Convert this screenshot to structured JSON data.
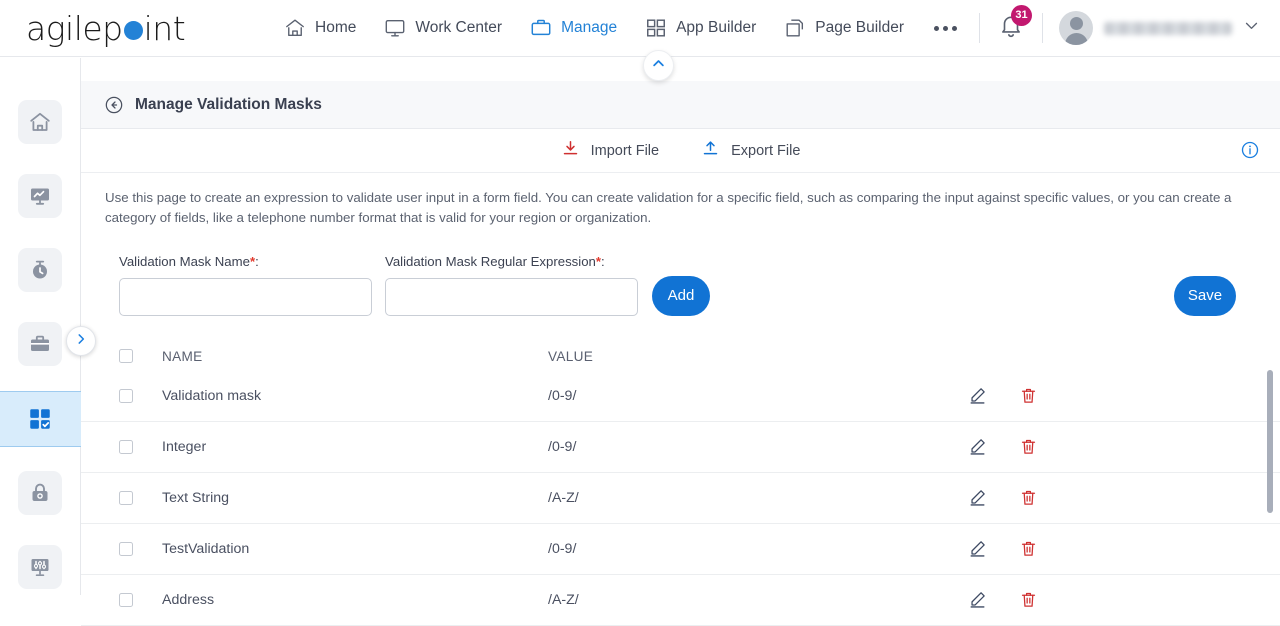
{
  "brand": {
    "name_part1": "agilep",
    "name_part2": "int"
  },
  "topnav": {
    "items": [
      {
        "label": "Home",
        "icon": "home-icon",
        "active": false
      },
      {
        "label": "Work Center",
        "icon": "monitor-icon",
        "active": false
      },
      {
        "label": "Manage",
        "icon": "briefcase-icon",
        "active": true
      },
      {
        "label": "App Builder",
        "icon": "grid-icon",
        "active": false
      },
      {
        "label": "Page Builder",
        "icon": "pages-icon",
        "active": false
      }
    ],
    "more_label": "•••",
    "notification_count": "31",
    "username": ""
  },
  "sidebar": {
    "items": [
      {
        "name": "home",
        "icon": "home-icon"
      },
      {
        "name": "reports",
        "icon": "analytics-monitor-icon"
      },
      {
        "name": "activity",
        "icon": "stopwatch-icon"
      },
      {
        "name": "work",
        "icon": "briefcase-icon"
      },
      {
        "name": "apps",
        "icon": "apps-check-icon"
      },
      {
        "name": "access",
        "icon": "lock-icon"
      },
      {
        "name": "settings",
        "icon": "sliders-icon"
      }
    ],
    "expand_icon": "chevron-right-icon"
  },
  "page": {
    "collapse_icon": "chevron-up-icon",
    "back_icon": "back-arrow-circle-icon",
    "title": "Manage Validation Masks",
    "info_icon": "info-circle-icon"
  },
  "toolbar": {
    "import_label": "Import File",
    "import_icon": "download-icon",
    "export_label": "Export File",
    "export_icon": "upload-icon"
  },
  "description": "Use this page to create an expression to validate user input in a form field. You can create validation for a specific field, such as comparing the input against specific values, or you can create a category of fields, like a telephone number format that is valid for your region or organization.",
  "form": {
    "name_label": "Validation Mask Name",
    "name_required": "*",
    "name_suffix": ":",
    "name_value": "",
    "name_placeholder": "",
    "regex_label": "Validation Mask Regular Expression",
    "regex_required": "*",
    "regex_suffix": ":",
    "regex_value": "",
    "regex_placeholder": "",
    "add_label": "Add",
    "save_label": "Save"
  },
  "table": {
    "columns": {
      "name": "NAME",
      "value": "VALUE"
    },
    "rows": [
      {
        "name": "Validation mask",
        "value": "/0-9/"
      },
      {
        "name": "Integer",
        "value": "/0-9/"
      },
      {
        "name": "Text String",
        "value": "/A-Z/"
      },
      {
        "name": "TestValidation",
        "value": "/0-9/"
      },
      {
        "name": "Address",
        "value": "/A-Z/"
      }
    ],
    "edit_icon": "pencil-icon",
    "delete_icon": "trash-icon"
  },
  "colors": {
    "accent": "#1173d4",
    "badge": "#c2186f",
    "danger": "#cf3030",
    "import": "#cf3030",
    "required": "#e23b2e"
  }
}
